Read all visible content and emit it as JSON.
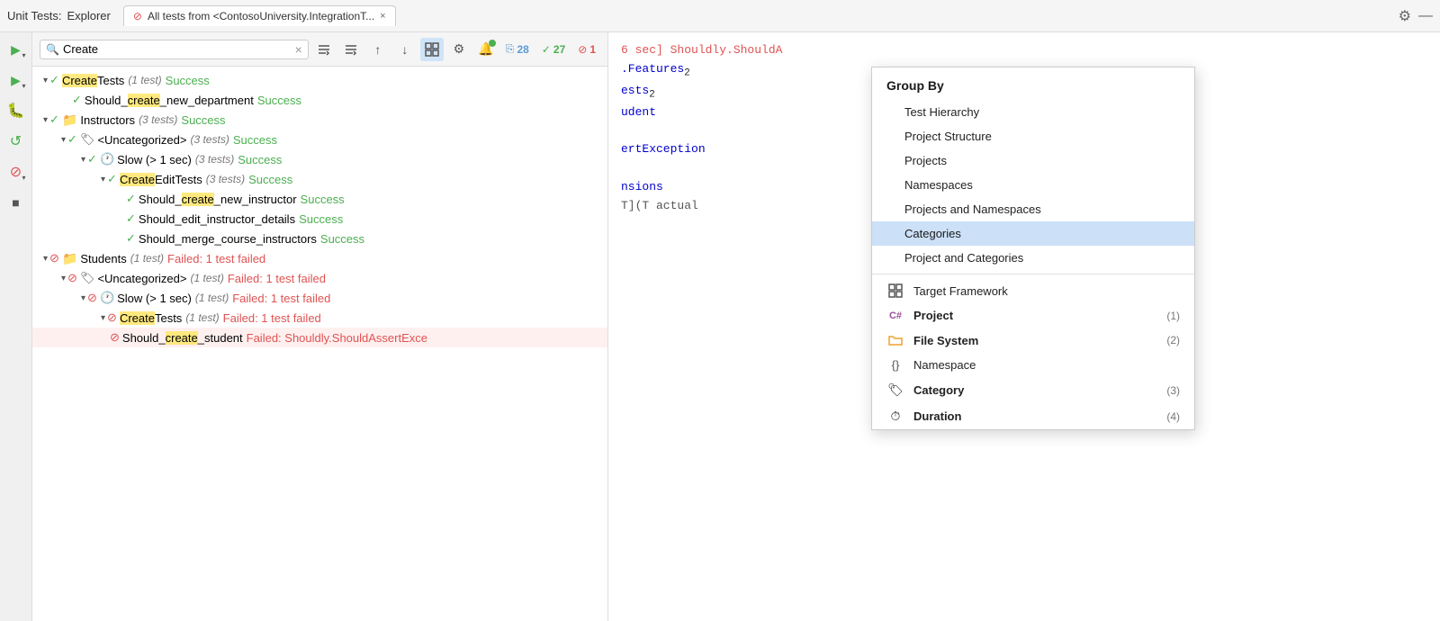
{
  "titlebar": {
    "app_label": "Unit Tests:",
    "tab_label": "Explorer",
    "tab_title": "All tests from <ContosoUniversity.IntegrationT...",
    "close_label": "×",
    "gear_icon": "⚙",
    "minimize_icon": "—"
  },
  "toolbar": {
    "search_value": "Create",
    "search_placeholder": "Search",
    "clear_icon": "×",
    "filter_icon_1": "≡↑",
    "filter_icon_2": "≡↓",
    "sort_asc_icon": "↑",
    "sort_desc_icon": "↓",
    "grid_icon": "⊞",
    "gear_icon": "⚙",
    "notification_icon": "🔔",
    "stat_link_count": "28",
    "stat_pass_count": "27",
    "stat_fail_count": "1"
  },
  "sidebar_icons": [
    {
      "name": "play-run",
      "icon": "▶",
      "color": "green"
    },
    {
      "name": "play-debug",
      "icon": "▶",
      "color": "green"
    },
    {
      "name": "bug",
      "icon": "🐛",
      "color": "green"
    },
    {
      "name": "refresh",
      "icon": "↺",
      "color": "green"
    },
    {
      "name": "stop",
      "icon": "⊘",
      "color": "red"
    },
    {
      "name": "stop-square",
      "icon": "■",
      "color": "gray"
    }
  ],
  "tree_items": [
    {
      "id": "createtests",
      "indent": 0,
      "chevron": "▾",
      "status": "pass",
      "name_prefix": "Create",
      "name_rest": "Tests",
      "meta": "(1 test)",
      "result": "Success",
      "result_type": "success"
    },
    {
      "id": "should_create_new_department",
      "indent": 1,
      "chevron": "",
      "status": "pass",
      "name_prefix": "",
      "name_rest": "Should_",
      "name_highlight": "create",
      "name_after": "_new_department",
      "meta": "",
      "result": "Success",
      "result_type": "success"
    },
    {
      "id": "instructors",
      "indent": 0,
      "chevron": "▾",
      "status": "pass",
      "folder": true,
      "name_rest": "Instructors",
      "meta": "(3 tests)",
      "result": "Success",
      "result_type": "success"
    },
    {
      "id": "uncategorized-instructors",
      "indent": 1,
      "chevron": "▾",
      "status": "pass",
      "tag": true,
      "name_rest": "<Uncategorized>",
      "meta": "(3 tests)",
      "result": "Success",
      "result_type": "success"
    },
    {
      "id": "slow-instructors",
      "indent": 2,
      "chevron": "▾",
      "status": "pass",
      "clock": true,
      "name_rest": "Slow (> 1 sec)",
      "meta": "(3 tests)",
      "result": "Success",
      "result_type": "success"
    },
    {
      "id": "createedittests",
      "indent": 3,
      "chevron": "▾",
      "status": "pass",
      "name_prefix": "Create",
      "name_rest": "EditTests",
      "meta": "(3 tests)",
      "result": "Success",
      "result_type": "success"
    },
    {
      "id": "should_create_new_instructor",
      "indent": 4,
      "chevron": "",
      "status": "pass",
      "name_rest": "Should_",
      "name_highlight": "create",
      "name_after": "_new_instructor",
      "meta": "",
      "result": "Success",
      "result_type": "success"
    },
    {
      "id": "should_edit_instructor_details",
      "indent": 4,
      "chevron": "",
      "status": "pass",
      "name_rest": "Should_edit_instructor_details",
      "meta": "",
      "result": "Success",
      "result_type": "success"
    },
    {
      "id": "should_merge_course_instructors",
      "indent": 4,
      "chevron": "",
      "status": "pass",
      "name_rest": "Should_merge_course_instructors",
      "meta": "",
      "result": "Success",
      "result_type": "success"
    },
    {
      "id": "students",
      "indent": 0,
      "chevron": "▾",
      "status": "fail",
      "folder": true,
      "name_rest": "Students",
      "meta": "(1 test)",
      "result": "Failed: 1 test failed",
      "result_type": "failed"
    },
    {
      "id": "uncategorized-students",
      "indent": 1,
      "chevron": "▾",
      "status": "fail",
      "tag": true,
      "name_rest": "<Uncategorized>",
      "meta": "(1 test)",
      "result": "Failed: 1 test failed",
      "result_type": "failed"
    },
    {
      "id": "slow-students",
      "indent": 2,
      "chevron": "▾",
      "status": "fail",
      "clock": true,
      "name_rest": "Slow (> 1 sec)",
      "meta": "(1 test)",
      "result": "Failed: 1 test failed",
      "result_type": "failed"
    },
    {
      "id": "createtests-students",
      "indent": 3,
      "chevron": "▾",
      "status": "fail",
      "name_prefix": "Create",
      "name_rest": "Tests",
      "meta": "(1 test)",
      "result": "Failed: 1 test failed",
      "result_type": "failed"
    },
    {
      "id": "should_create_student",
      "indent": 4,
      "chevron": "",
      "status": "fail",
      "name_rest": "Should_",
      "name_highlight": "create",
      "name_after": "_student",
      "meta": "",
      "result": "Failed: Shouldly.ShouldAssertExce",
      "result_type": "failed",
      "is_last_row": true
    }
  ],
  "dropdown": {
    "title": "Group By",
    "plain_items": [
      {
        "id": "test-hierarchy",
        "label": "Test Hierarchy",
        "selected": false
      },
      {
        "id": "project-structure",
        "label": "Project Structure",
        "selected": false
      },
      {
        "id": "projects",
        "label": "Projects",
        "selected": false
      },
      {
        "id": "namespaces",
        "label": "Namespaces",
        "selected": false
      },
      {
        "id": "projects-and-namespaces",
        "label": "Projects and Namespaces",
        "selected": false
      },
      {
        "id": "categories",
        "label": "Categories",
        "selected": true
      },
      {
        "id": "project-and-categories",
        "label": "Project and Categories",
        "selected": false
      }
    ],
    "icon_items": [
      {
        "id": "target-framework",
        "icon": "⊞",
        "icon_class": "icon-grid",
        "label": "Target Framework",
        "bold": false,
        "count": ""
      },
      {
        "id": "project",
        "icon": "C#",
        "icon_class": "icon-csharp",
        "label": "Project",
        "bold": true,
        "count": "(1)"
      },
      {
        "id": "file-system",
        "icon": "🗂",
        "icon_class": "icon-folder-orange",
        "label": "File System",
        "bold": true,
        "count": "(2)"
      },
      {
        "id": "namespace",
        "icon": "{}",
        "icon_class": "icon-namespace",
        "label": "Namespace",
        "bold": false,
        "count": ""
      },
      {
        "id": "category",
        "icon": "🏷",
        "icon_class": "icon-category",
        "label": "Category",
        "bold": true,
        "count": "(3)"
      },
      {
        "id": "duration",
        "icon": "⏱",
        "icon_class": "icon-clock",
        "label": "Duration",
        "bold": true,
        "count": "(4)"
      }
    ]
  },
  "right_panel_lines": [
    {
      "text": "6 sec] Shouldly.ShouldA",
      "color": "red"
    },
    {
      "text": ".Features₂",
      "parts": [
        {
          "text": ".Features",
          "color": "blue"
        },
        {
          "text": "₂",
          "color": "sub"
        }
      ]
    },
    {
      "text": "ests₂",
      "parts": [
        {
          "text": "ests",
          "color": "blue"
        },
        {
          "text": "₂",
          "color": "sub"
        }
      ]
    },
    {
      "text": "udent",
      "color": "blue"
    },
    {
      "text": ""
    },
    {
      "text": "ertException",
      "color": "blue"
    },
    {
      "text": ""
    },
    {
      "text": "nsions",
      "color": "blue"
    },
    {
      "text": "T](T actual",
      "color": "gray"
    }
  ]
}
